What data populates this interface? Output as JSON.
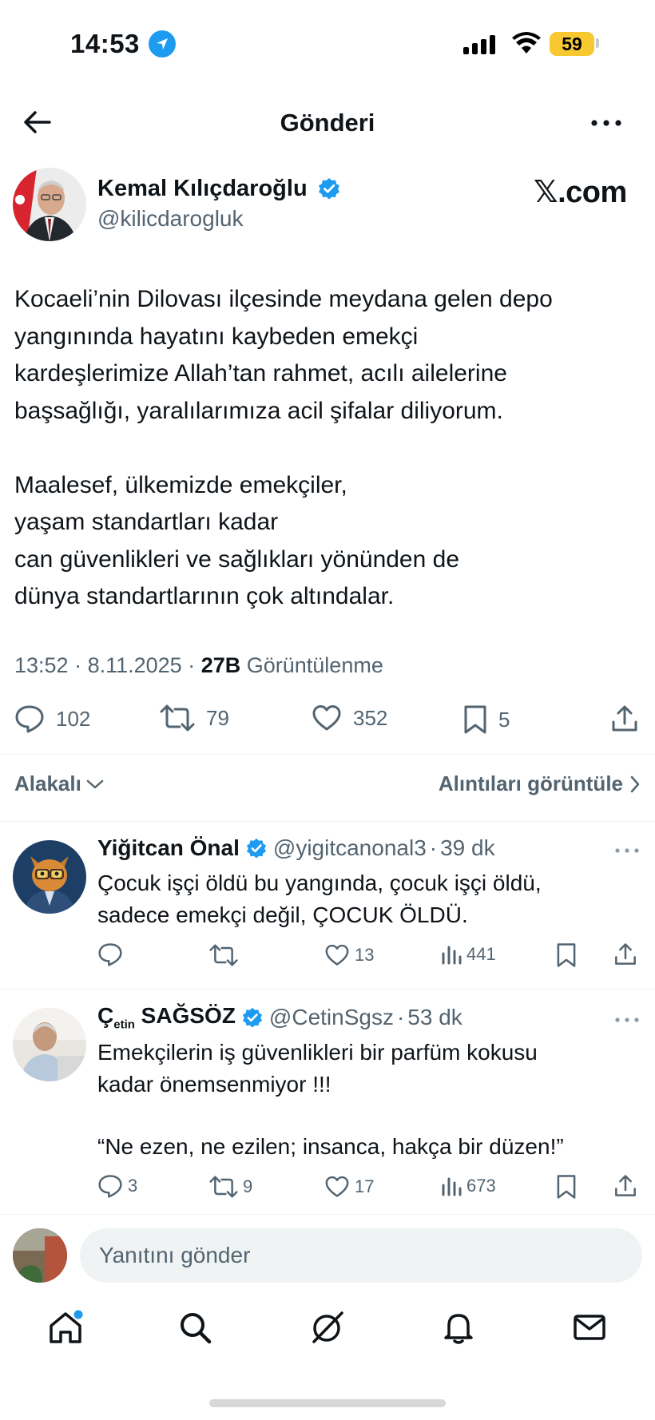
{
  "status_bar": {
    "time": "14:53",
    "battery": "59",
    "icons": [
      "location-arrow-icon",
      "cellular-signal-icon",
      "wifi-icon",
      "battery-icon"
    ]
  },
  "header": {
    "title": "Gönderi",
    "back_icon": "arrow-left-icon",
    "more_icon": "more-horizontal-icon"
  },
  "post": {
    "author_name": "Kemal Kılıçdaroğlu",
    "author_handle": "@kilicdarogluk",
    "watermark": "𝕏.com",
    "paragraph1": [
      "Kocaeli’nin Dilovası ilçesinde meydana gelen depo",
      "yangınında hayatını kaybeden emekçi",
      "kardeşlerimize Allah’tan rahmet, acılı ailelerine",
      "başsağlığı, yaralılarımıza acil şifalar diliyorum."
    ],
    "paragraph2": [
      "Maalesef, ülkemizde emekçiler,",
      "yaşam standartları kadar",
      "can güvenlikleri ve sağlıkları yönünden de",
      "dünya standartlarının çok altındalar."
    ],
    "time": "13:52",
    "date": "8.11.2025",
    "views_count": "27B",
    "views_label": "Görüntülenme",
    "replies": "102",
    "reposts": "79",
    "likes": "352",
    "bookmarks": "5"
  },
  "filter": {
    "sort_label": "Alakalı",
    "quotes_label": "Alıntıları görüntüle"
  },
  "replies": [
    {
      "name": "Yiğitcan Önal",
      "handle": "@yigitcanonal3",
      "time": "39 dk",
      "lines": [
        "Çocuk işçi öldü bu yangında, çocuk işçi öldü,",
        "sadece emekçi değil, ÇOCUK ÖLDÜ."
      ],
      "replies": "",
      "reposts": "",
      "likes": "13",
      "views": "441"
    },
    {
      "name_part1": "Ç",
      "name_sub": "etin",
      "name_part2": " SAĞSÖZ",
      "handle": "@CetinSgsz",
      "time": "53 dk",
      "lines": [
        "Emekçilerin iş güvenlikleri bir parfüm kokusu",
        "kadar önemsenmiyor !!!"
      ],
      "quote": "“Ne ezen, ne ezilen; insanca, hakça bir düzen!”",
      "replies": "3",
      "reposts": "9",
      "likes": "17",
      "views": "673"
    }
  ],
  "composer": {
    "placeholder": "Yanıtını gönder"
  },
  "nav": {
    "items": [
      "home-icon",
      "search-icon",
      "grok-icon",
      "notifications-bell-icon",
      "messages-envelope-icon"
    ]
  },
  "colors": {
    "accent": "#1d9bf0",
    "text": "#0f1419",
    "secondary": "#536471",
    "battery": "#f7c830"
  }
}
